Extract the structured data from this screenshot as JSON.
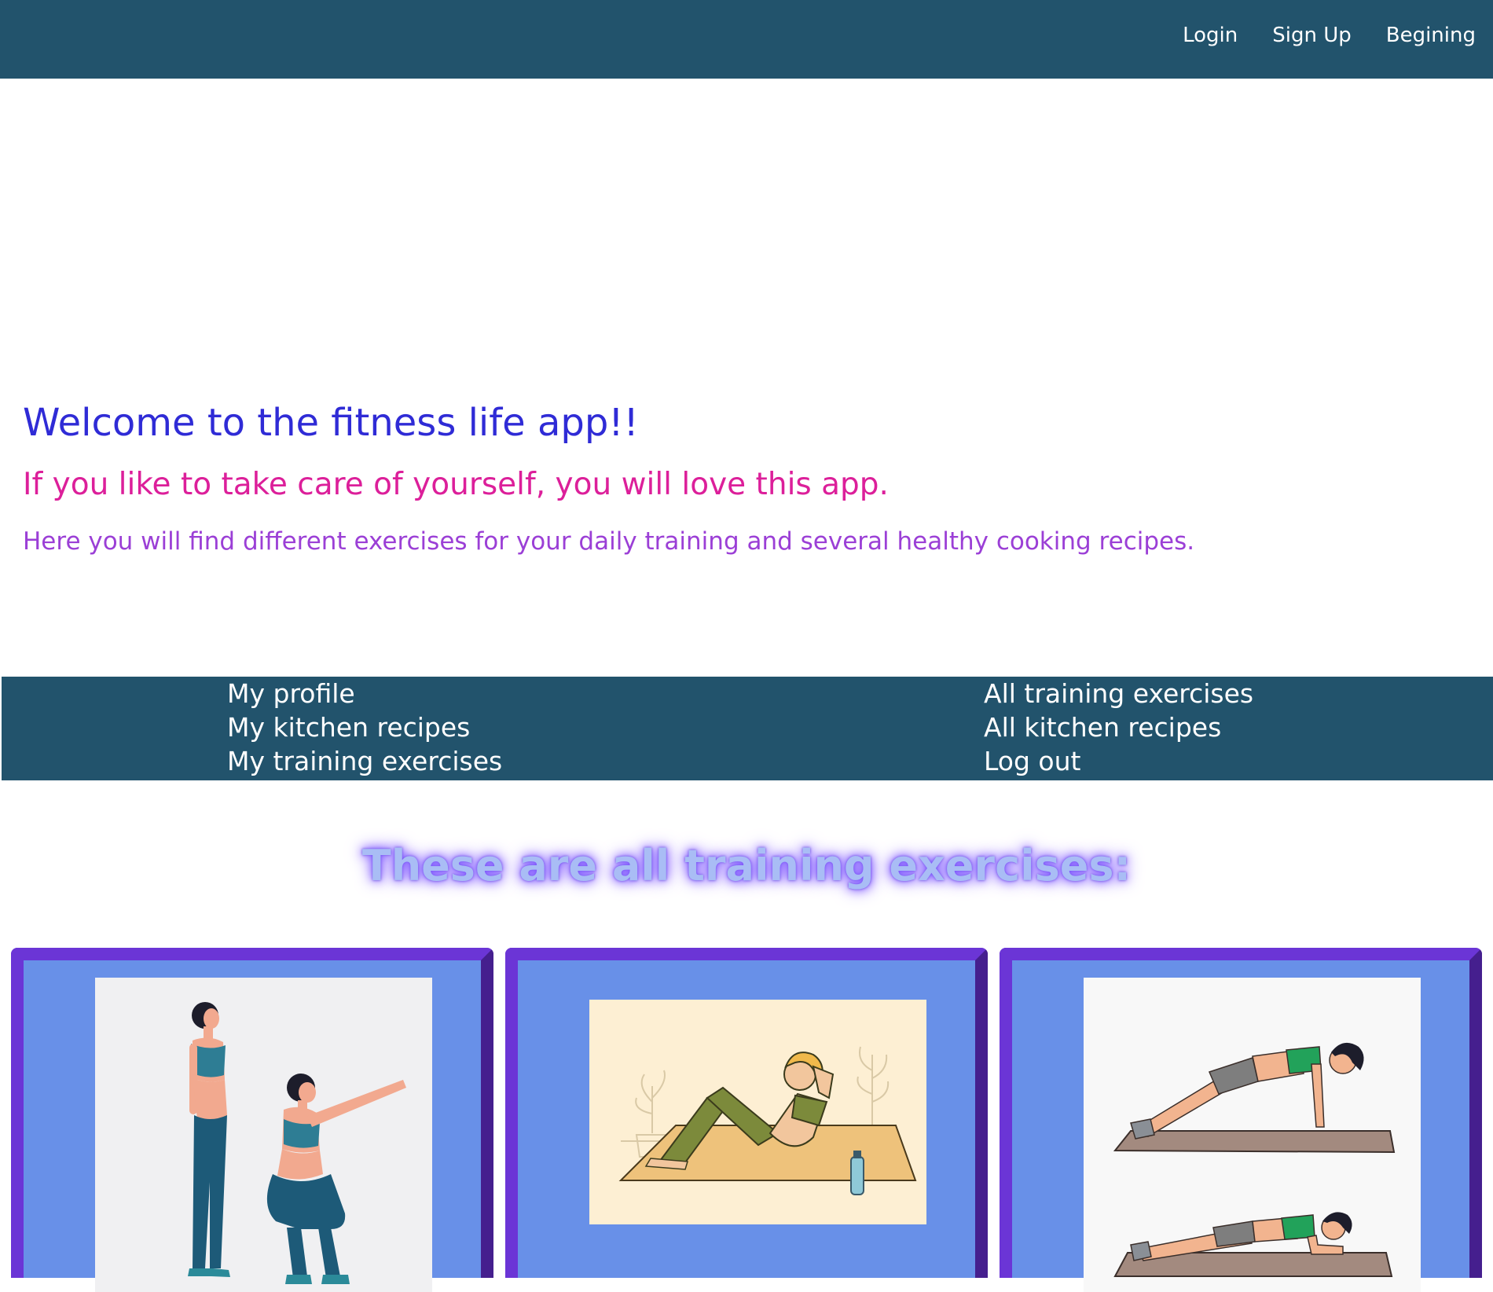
{
  "topnav": {
    "login": "Login",
    "signup": "Sign Up",
    "begining": "Begining"
  },
  "hero": {
    "title": "Welcome to the fitness life app!!",
    "subtitle": "If you like to take care of yourself, you will love this app.",
    "description": "Here you will find different exercises for your daily training and several healthy cooking recipes."
  },
  "usermenu": {
    "left": [
      "My profile",
      "My kitchen recipes",
      "My training exercises"
    ],
    "right": [
      "All training exercises",
      "All kitchen recipes",
      "Log out"
    ]
  },
  "section": {
    "title": "These are all training exercises:"
  },
  "colors": {
    "navbar": "#22536c",
    "title": "#2f2bd6",
    "subtitle": "#dc1f9a",
    "description": "#9b3fd6",
    "card_bg": "#6890e8",
    "card_border": "#6b35d6"
  },
  "cards": [
    {
      "image": "squat-exercise-illustration"
    },
    {
      "image": "crunch-exercise-illustration"
    },
    {
      "image": "plank-exercise-illustration"
    }
  ]
}
